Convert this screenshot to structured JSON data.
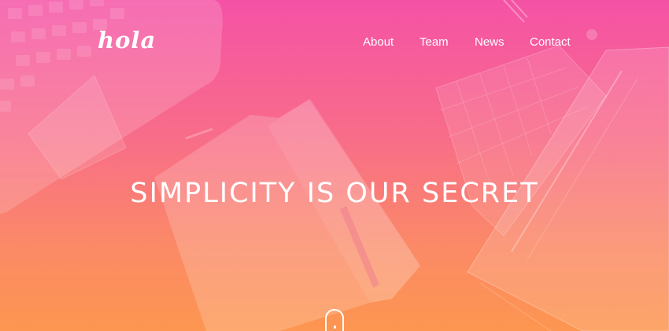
{
  "brand": {
    "logo_text": "hola"
  },
  "nav": {
    "items": [
      {
        "label": "About"
      },
      {
        "label": "Team"
      },
      {
        "label": "News"
      },
      {
        "label": "Contact"
      }
    ]
  },
  "hero": {
    "headline": "SIMPLICITY IS OUR SECRET",
    "scroll_icon": "mouse-scroll-icon",
    "gradient_top": "#f552a6",
    "gradient_bottom": "#fd9650"
  }
}
